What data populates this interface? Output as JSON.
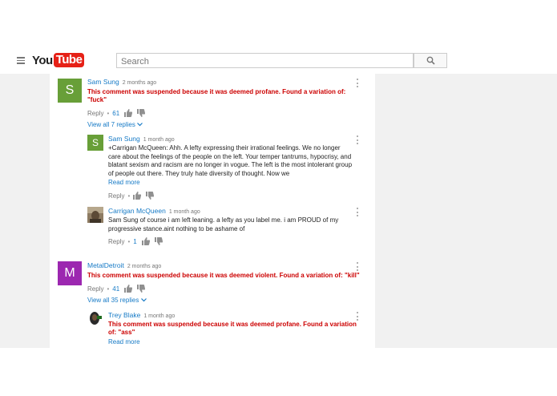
{
  "header": {
    "logo_you": "You",
    "logo_tube": "Tube",
    "search_placeholder": "Search"
  },
  "colors": {
    "link_blue": "#167ac6",
    "suspended_red": "#cc0000",
    "avatar_green": "#689f38",
    "avatar_purple": "#9c27b0",
    "youtube_red": "#e62117"
  },
  "comments": [
    {
      "avatar_letter": "S",
      "author": "Sam Sung",
      "time": "2 months ago",
      "text": "This comment was suspended because it was deemed profane. Found a variation of: \"fuck\"",
      "reply_label": "Reply",
      "likes": "61",
      "view_replies": "View all 7 replies"
    },
    {
      "avatar_letter": "S",
      "author": "Sam Sung",
      "time": "1 month ago",
      "text": "+Carrigan McQueen: Ahh.  A lefty expressing their irrational feelings. We no longer care about the feelings of the people on the left.  Your  temper tantrums, hypocrisy, and blatant sexism and racism are no longer in vogue.  The left is the most intolerant group of people out there. They truly hate diversity of thought. Now we",
      "read_more": "Read more",
      "reply_label": "Reply"
    },
    {
      "author": "Carrigan McQueen",
      "time": "1 month ago",
      "text": "Sam Sung of course i am left leaning. a lefty as you label me. i am PROUD of my progressive stance.aint nothing to be ashame of",
      "reply_label": "Reply",
      "likes": "1"
    },
    {
      "avatar_letter": "M",
      "author": "MetalDetroit",
      "time": "2 months ago",
      "text": "This comment was suspended because it was deemed violent. Found a variation of: \"kill\"",
      "reply_label": "Reply",
      "likes": "41",
      "view_replies": "View all 35 replies"
    },
    {
      "author": "Trey Blake",
      "time": "1 month ago",
      "text": "This comment was suspended because it was deemed profane. Found a variation of: \"ass\"",
      "read_more": "Read more"
    }
  ]
}
